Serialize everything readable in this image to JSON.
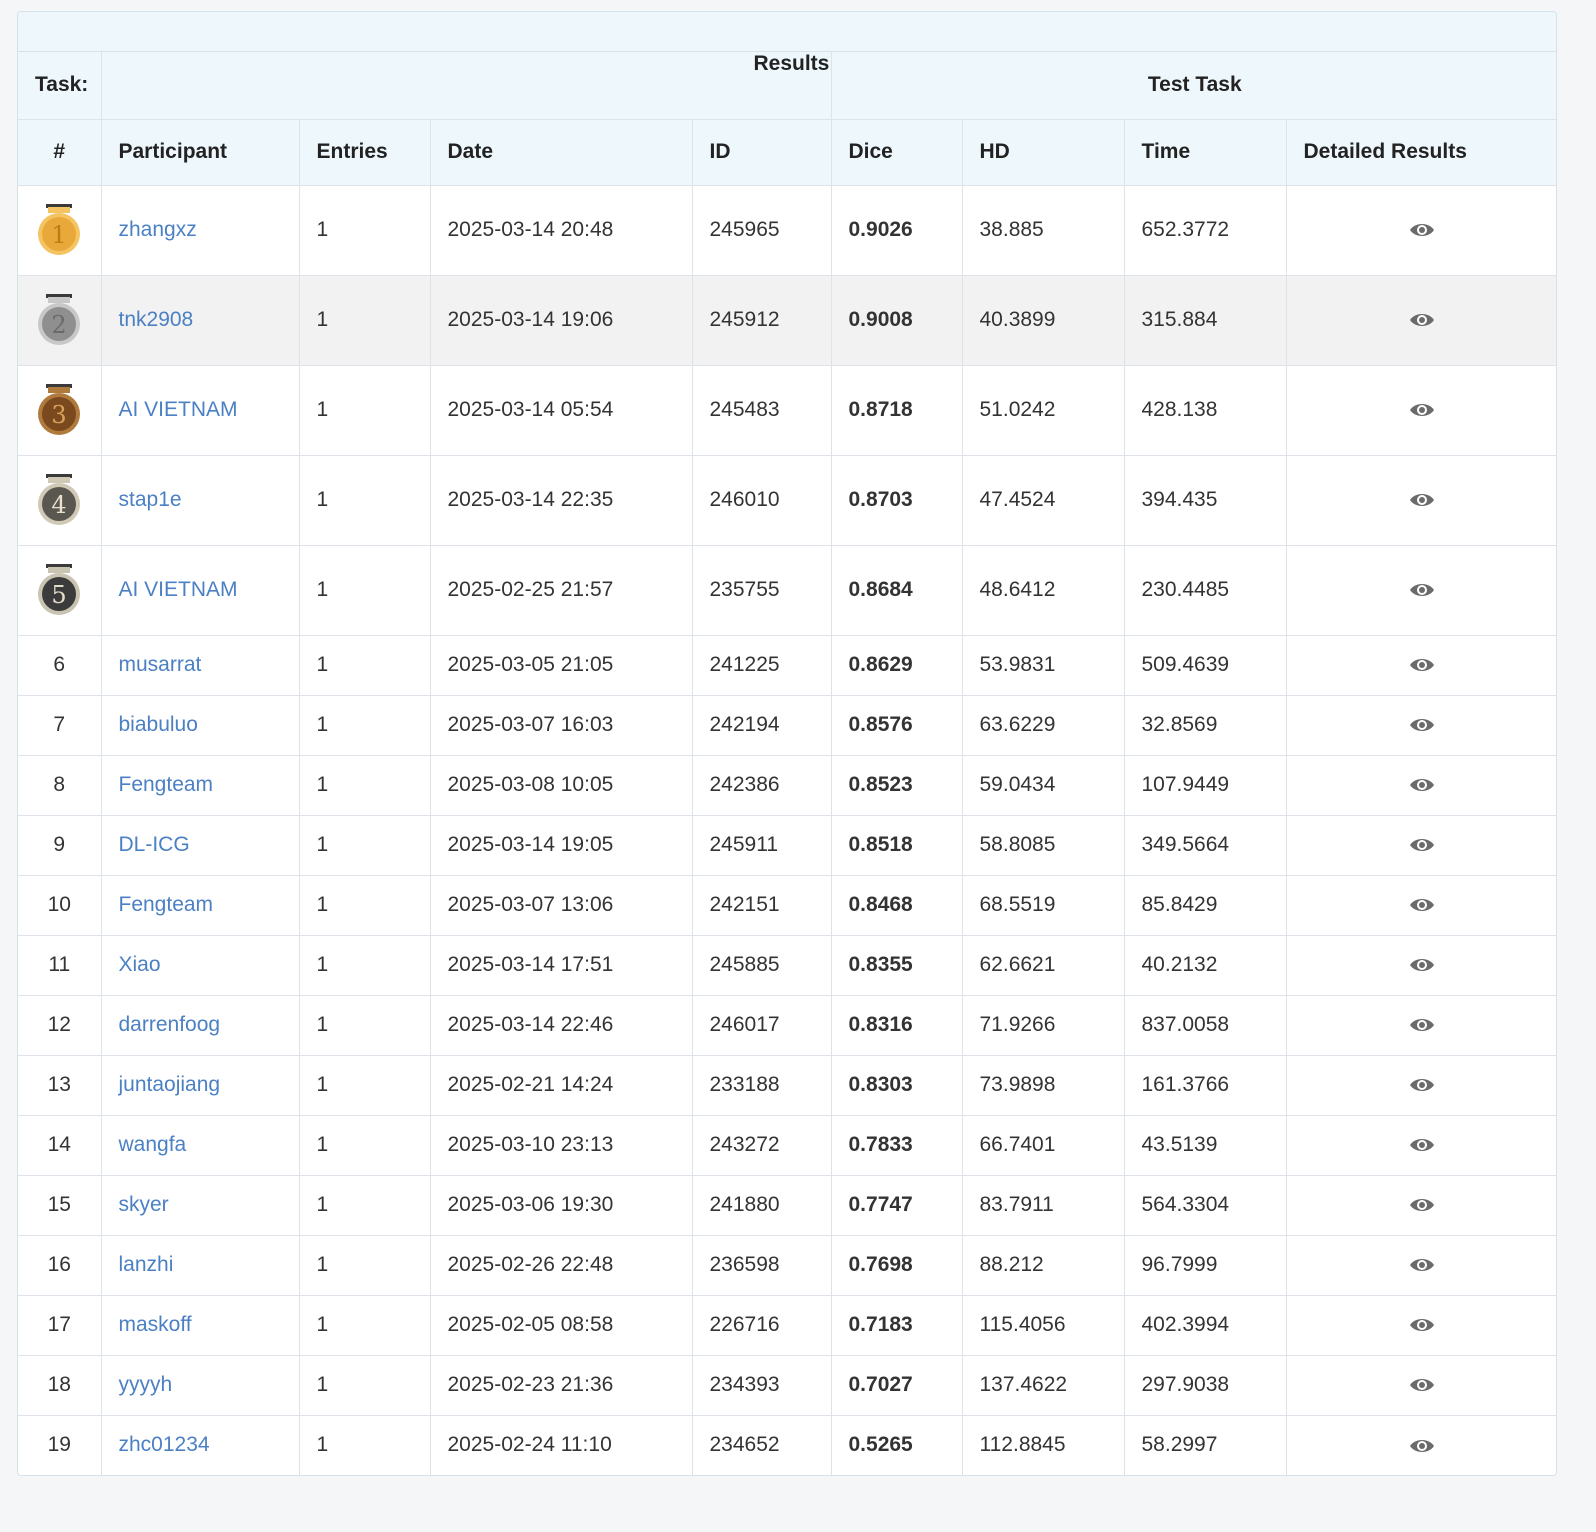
{
  "table": {
    "task_label": "Task:",
    "results_label": "Results",
    "test_task_label": "Test Task",
    "columns": [
      "#",
      "Participant",
      "Entries",
      "Date",
      "ID",
      "Dice",
      "HD",
      "Time",
      "Detailed Results"
    ],
    "rows": [
      {
        "rank": "1",
        "participant": "zhangxz",
        "entries": "1",
        "date": "2025-03-14 20:48",
        "id": "245965",
        "dice": "0.9026",
        "hd": "38.885",
        "time": "652.3772"
      },
      {
        "rank": "2",
        "participant": "tnk2908",
        "entries": "1",
        "date": "2025-03-14 19:06",
        "id": "245912",
        "dice": "0.9008",
        "hd": "40.3899",
        "time": "315.884"
      },
      {
        "rank": "3",
        "participant": "AI VIETNAM",
        "entries": "1",
        "date": "2025-03-14 05:54",
        "id": "245483",
        "dice": "0.8718",
        "hd": "51.0242",
        "time": "428.138"
      },
      {
        "rank": "4",
        "participant": "stap1e",
        "entries": "1",
        "date": "2025-03-14 22:35",
        "id": "246010",
        "dice": "0.8703",
        "hd": "47.4524",
        "time": "394.435"
      },
      {
        "rank": "5",
        "participant": "AI VIETNAM",
        "entries": "1",
        "date": "2025-02-25 21:57",
        "id": "235755",
        "dice": "0.8684",
        "hd": "48.6412",
        "time": "230.4485"
      },
      {
        "rank": "6",
        "participant": "musarrat",
        "entries": "1",
        "date": "2025-03-05 21:05",
        "id": "241225",
        "dice": "0.8629",
        "hd": "53.9831",
        "time": "509.4639"
      },
      {
        "rank": "7",
        "participant": "biabuluo",
        "entries": "1",
        "date": "2025-03-07 16:03",
        "id": "242194",
        "dice": "0.8576",
        "hd": "63.6229",
        "time": "32.8569"
      },
      {
        "rank": "8",
        "participant": "Fengteam",
        "entries": "1",
        "date": "2025-03-08 10:05",
        "id": "242386",
        "dice": "0.8523",
        "hd": "59.0434",
        "time": "107.9449"
      },
      {
        "rank": "9",
        "participant": "DL-ICG",
        "entries": "1",
        "date": "2025-03-14 19:05",
        "id": "245911",
        "dice": "0.8518",
        "hd": "58.8085",
        "time": "349.5664"
      },
      {
        "rank": "10",
        "participant": "Fengteam",
        "entries": "1",
        "date": "2025-03-07 13:06",
        "id": "242151",
        "dice": "0.8468",
        "hd": "68.5519",
        "time": "85.8429"
      },
      {
        "rank": "11",
        "participant": "Xiao",
        "entries": "1",
        "date": "2025-03-14 17:51",
        "id": "245885",
        "dice": "0.8355",
        "hd": "62.6621",
        "time": "40.2132"
      },
      {
        "rank": "12",
        "participant": "darrenfoog",
        "entries": "1",
        "date": "2025-03-14 22:46",
        "id": "246017",
        "dice": "0.8316",
        "hd": "71.9266",
        "time": "837.0058"
      },
      {
        "rank": "13",
        "participant": "juntaojiang",
        "entries": "1",
        "date": "2025-02-21 14:24",
        "id": "233188",
        "dice": "0.8303",
        "hd": "73.9898",
        "time": "161.3766"
      },
      {
        "rank": "14",
        "participant": "wangfa",
        "entries": "1",
        "date": "2025-03-10 23:13",
        "id": "243272",
        "dice": "0.7833",
        "hd": "66.7401",
        "time": "43.5139"
      },
      {
        "rank": "15",
        "participant": "skyer",
        "entries": "1",
        "date": "2025-03-06 19:30",
        "id": "241880",
        "dice": "0.7747",
        "hd": "83.7911",
        "time": "564.3304"
      },
      {
        "rank": "16",
        "participant": "lanzhi",
        "entries": "1",
        "date": "2025-02-26 22:48",
        "id": "236598",
        "dice": "0.7698",
        "hd": "88.212",
        "time": "96.7999"
      },
      {
        "rank": "17",
        "participant": "maskoff",
        "entries": "1",
        "date": "2025-02-05 08:58",
        "id": "226716",
        "dice": "0.7183",
        "hd": "115.4056",
        "time": "402.3994"
      },
      {
        "rank": "18",
        "participant": "yyyyh",
        "entries": "1",
        "date": "2025-02-23 21:36",
        "id": "234393",
        "dice": "0.7027",
        "hd": "137.4622",
        "time": "297.9038"
      },
      {
        "rank": "19",
        "participant": "zhc01234",
        "entries": "1",
        "date": "2025-02-24 11:10",
        "id": "234652",
        "dice": "0.5265",
        "hd": "112.8845",
        "time": "58.2997"
      }
    ]
  },
  "medals": [
    {
      "name": "gold-medal-icon",
      "fill": "#e9a93a",
      "rim": "#f4c462",
      "text": "#c07a15"
    },
    {
      "name": "silver-medal-icon",
      "fill": "#8f8f8f",
      "rim": "#c8c8c8",
      "text": "#6a6a6a"
    },
    {
      "name": "bronze-medal-icon",
      "fill": "#7a4a1e",
      "rim": "#b07a3c",
      "text": "#d9a25a"
    },
    {
      "name": "fourth-medal-icon",
      "fill": "#5a5750",
      "rim": "#cfc9b6",
      "text": "#e6e0cc"
    },
    {
      "name": "fifth-medal-icon",
      "fill": "#3b3b3b",
      "rim": "#c9c3b2",
      "text": "#e2dccb"
    }
  ],
  "highlighted_row_rank": "2",
  "icons": {
    "detail": "eye-icon"
  }
}
